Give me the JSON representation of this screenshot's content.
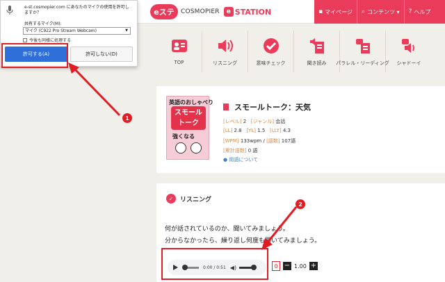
{
  "header": {
    "logo_mark": "eステ",
    "logo_brand": "COSMOPIER",
    "logo_station_icon": "e",
    "logo_station": "STATION",
    "nav": [
      {
        "icon": "user-icon",
        "glyph": "▪",
        "label": "マイページ"
      },
      {
        "icon": "search-icon",
        "glyph": "⌕",
        "label": "コンテンツ ▾"
      },
      {
        "icon": "help-icon",
        "glyph": "?",
        "label": "ヘルプ"
      }
    ]
  },
  "menu": [
    {
      "label": "TOP",
      "icon": "id-card-icon"
    },
    {
      "label": "リスニング",
      "icon": "speaker-icon"
    },
    {
      "label": "意味チェック",
      "icon": "check-circle-icon"
    },
    {
      "label": "聞き読み",
      "icon": "listen-read-icon"
    },
    {
      "label": "パラレル・リーディング",
      "icon": "parallel-reading-icon"
    },
    {
      "label": "シャドーイ",
      "icon": "shadowing-icon"
    }
  ],
  "material": {
    "book_line1": "英語のおしゃべり",
    "book_line2": "スモール\nトーク",
    "book_line3": "強くなる",
    "title": "スモールトーク：天気",
    "level_key": "[レベル]",
    "level_val": "2",
    "genre_key": "[ジャンル]",
    "genre_val": "会話",
    "ll_key": "[LL]",
    "ll_val": "2.8",
    "yl_key": "[YL]",
    "yl_val": "1.5",
    "lly_key": "[LLY]",
    "lly_val": "4.3",
    "wpm_key": "[WPM]",
    "wpm_val": "133wpm /",
    "words_key": "[語数]",
    "words_val": "107語",
    "cumulative_key": "[累計語数]",
    "cumulative_val": "0 語",
    "terms_link": "用語について"
  },
  "listening": {
    "heading": "リスニング",
    "line1": "何が話されているのか、聞いてみましょう。",
    "line2": "分からなかったら、繰り返し何度も聞いてみましょう。",
    "time": "0:00 / 0:51",
    "counter": "0",
    "minus": "−",
    "speed": "1.00",
    "plus": "+"
  },
  "popup": {
    "question": "e-st.cosmopier.com にあなたのマイクの使用を許可しますか？",
    "shared_label": "共有するマイク(M):",
    "selected_mic": "マイク (C922 Pro Stream Webcam)",
    "remember": "今後も同様に処理する",
    "allow": "許可する(A)",
    "deny": "許可しない(D)"
  },
  "annotations": {
    "one": "1",
    "two": "2",
    "color": "#e21c23"
  }
}
